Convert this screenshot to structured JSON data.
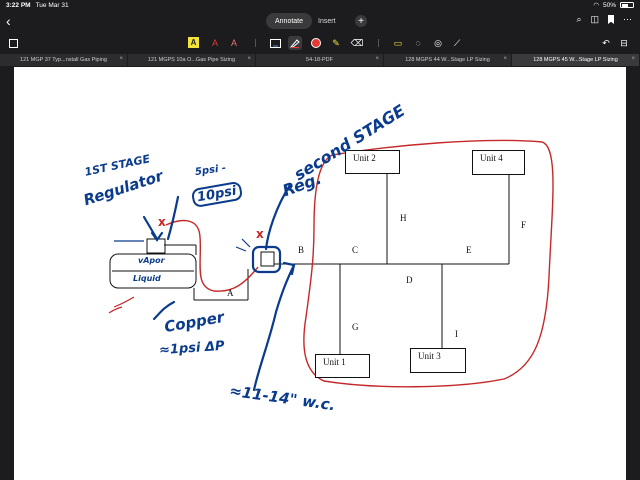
{
  "status": {
    "time": "3:22 PM",
    "date": "Tue Mar 31",
    "battery": "50%",
    "battery_level": 0.5
  },
  "nav": {
    "back_icon": "chevron-left-icon",
    "tab_annotate": "Annotate",
    "tab_insert": "Insert",
    "add_icon": "plus-icon"
  },
  "doc_tabs": [
    {
      "label": "121 MGP 37 Typ...nstall Gas Piping",
      "close": "×"
    },
    {
      "label": "121 MGPS 10a O...Gas Pipe Sizing",
      "close": "×"
    },
    {
      "label": "54-18-PDF",
      "close": "×"
    },
    {
      "label": "128 MGPS 44 W...Stage LP Sizing",
      "close": "×"
    },
    {
      "label": "128 MGPS 45 W...Stage LP Sizing",
      "close": "×"
    }
  ],
  "toolbar": {
    "highlight_a": "A",
    "text_a_red": "A",
    "text_a_dark": "A",
    "pen_color": "#e53935",
    "highlighter_color": "#f2e23a"
  },
  "diagram": {
    "units": {
      "unit1": "Unit 1",
      "unit2": "Unit 2",
      "unit3": "Unit 3",
      "unit4": "Unit 4"
    },
    "segments": {
      "a": "A",
      "b": "B",
      "c": "C",
      "d": "D",
      "e": "E",
      "f": "F",
      "g": "G",
      "h": "H",
      "i": "I"
    },
    "tank": {
      "vapor": "vApor",
      "liquid": "Liquid"
    }
  },
  "annotations": {
    "first_stage_1": "1ST STAGE",
    "first_stage_2": "Regulator",
    "psi_top": "5psi -",
    "psi_box": "10psi",
    "second_stage_1": "second STAGE",
    "second_stage_2": "Reg.",
    "copper": "Copper",
    "delta_p": "≈1psi ΔP",
    "wc": "≈11-14\" w.c.",
    "x_mark": "x",
    "ink_blue": "#0a3b8c",
    "ink_red": "#c62828"
  }
}
